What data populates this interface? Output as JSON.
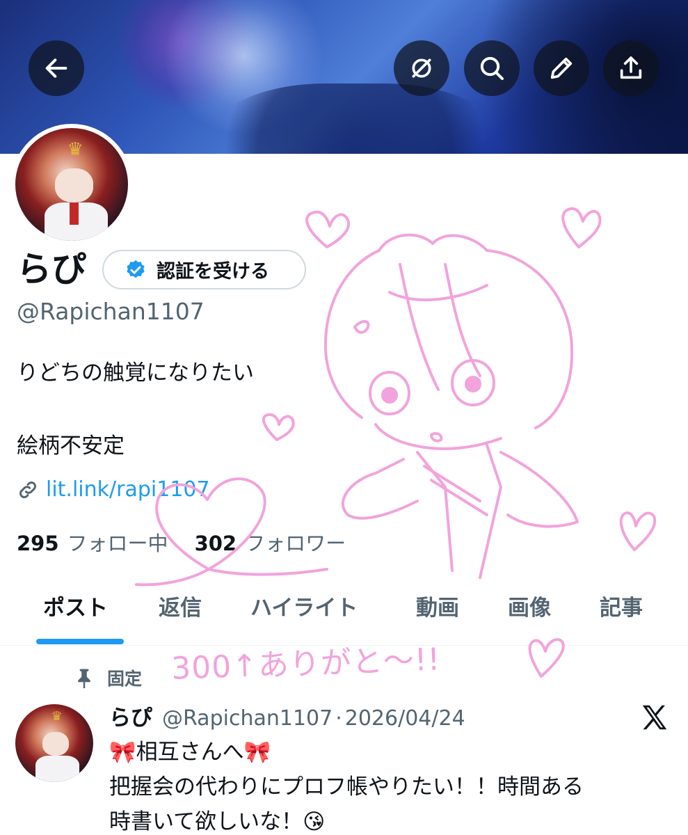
{
  "header": {
    "buttons": [
      {
        "name": "back-button",
        "icon": "arrow-left-icon"
      },
      {
        "name": "grok-button",
        "icon": "slash-circle-icon"
      },
      {
        "name": "search-button",
        "icon": "search-icon"
      },
      {
        "name": "edit-button",
        "icon": "pencil-icon"
      },
      {
        "name": "share-button",
        "icon": "share-icon"
      }
    ]
  },
  "profile": {
    "display_name": "らぴ",
    "verify_label": "認証を受ける",
    "handle": "@Rapichan1107",
    "bio_line1": "りどちの触覚になりたい",
    "bio_line2": "絵柄不安定",
    "link": "lit.link/rapi1107",
    "following_count": "295",
    "following_label": "フォロー中",
    "followers_count": "302",
    "followers_label": "フォロワー"
  },
  "tabs": [
    {
      "label": "ポスト",
      "active": true
    },
    {
      "label": "返信",
      "active": false
    },
    {
      "label": "ハイライト",
      "active": false
    },
    {
      "label": "動画",
      "active": false
    },
    {
      "label": "画像",
      "active": false
    },
    {
      "label": "記事",
      "active": false
    }
  ],
  "pinned_post": {
    "pinned_label": "固定",
    "author_name": "らぴ",
    "author_handle": "@Rapichan1107",
    "separator": "·",
    "date": "2026/04/24",
    "line1": "🎀相互さんへ🎀",
    "line2": "把握会の代わりにプロフ帳やりたい！！時間ある",
    "line3": "時書いて欲しいな！😘"
  },
  "doodle": {
    "caption": "300↑ありがと〜!!",
    "color": "#f2a3dc"
  },
  "colors": {
    "accent": "#1d9bf0",
    "text_primary": "#0f1419",
    "text_secondary": "#536471"
  }
}
